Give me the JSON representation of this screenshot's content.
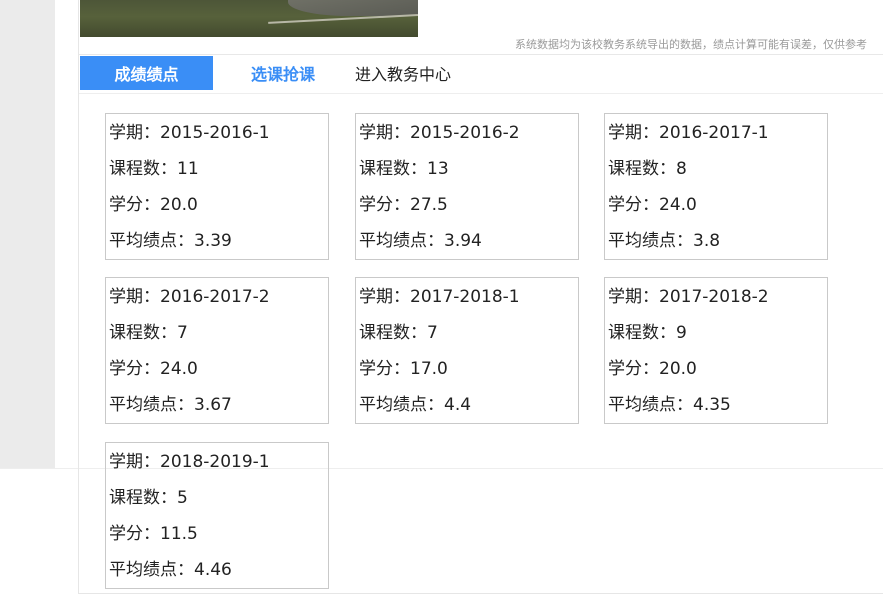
{
  "notice": "系统数据均为该校教务系统导出的数据，绩点计算可能有误差，仅供参考",
  "tabs": [
    {
      "label": "成绩绩点",
      "active": true
    },
    {
      "label": "选课抢课",
      "active": false
    },
    {
      "label": "进入教务中心",
      "active": false
    }
  ],
  "labels": {
    "term": "学期：",
    "courses": "课程数：",
    "credits": "学分：",
    "gpa": "平均绩点："
  },
  "terms": [
    {
      "term": "2015-2016-1",
      "courses": "11",
      "credits": "20.0",
      "gpa": "3.39"
    },
    {
      "term": "2015-2016-2",
      "courses": "13",
      "credits": "27.5",
      "gpa": "3.94"
    },
    {
      "term": "2016-2017-1",
      "courses": "8",
      "credits": "24.0",
      "gpa": "3.8"
    },
    {
      "term": "2016-2017-2",
      "courses": "7",
      "credits": "24.0",
      "gpa": "3.67"
    },
    {
      "term": "2017-2018-1",
      "courses": "7",
      "credits": "17.0",
      "gpa": "4.4"
    },
    {
      "term": "2017-2018-2",
      "courses": "9",
      "credits": "20.0",
      "gpa": "4.35"
    },
    {
      "term": "2018-2019-1",
      "courses": "5",
      "credits": "11.5",
      "gpa": "4.46"
    }
  ],
  "colors": {
    "accent": "#3a8ef6",
    "card_border": "#c9c9c9",
    "sidebar_bg": "#ebebeb"
  }
}
